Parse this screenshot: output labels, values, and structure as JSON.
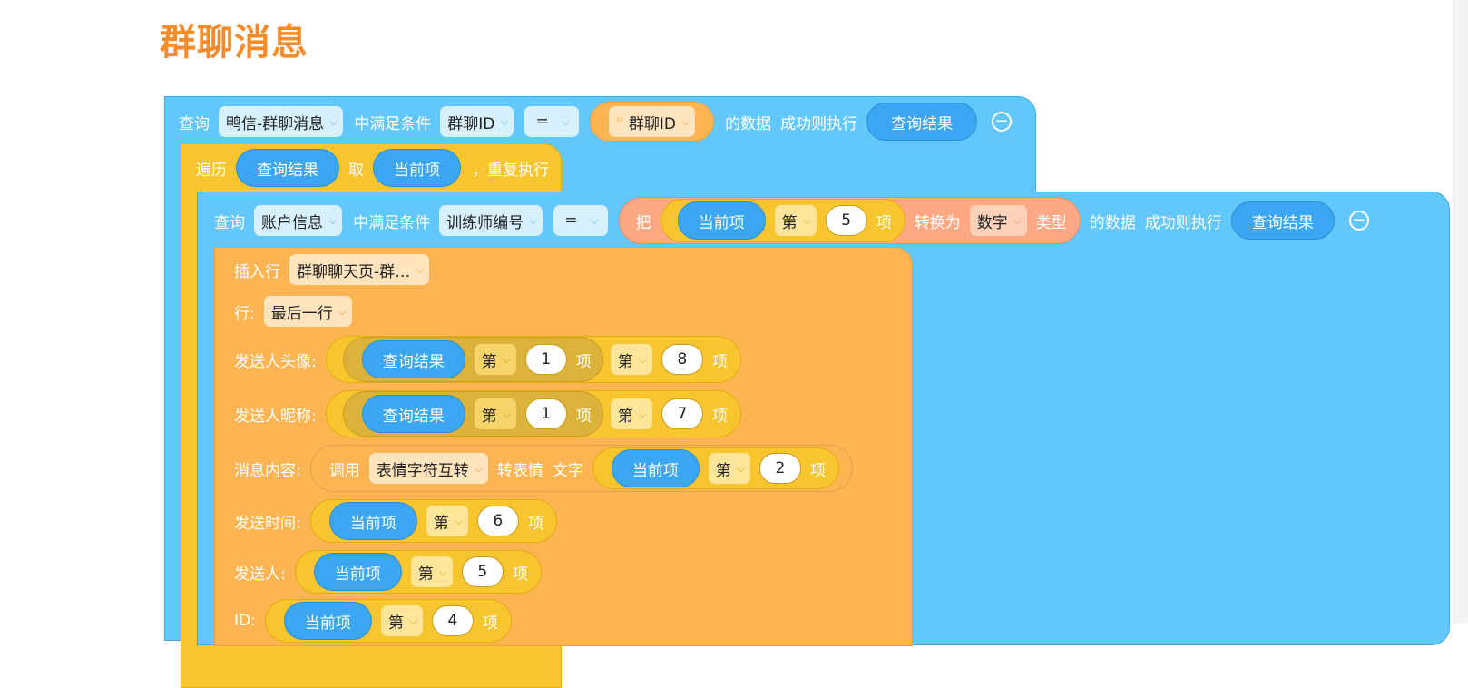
{
  "title": "群聊消息",
  "block1": {
    "kw_query": "查询",
    "table": "鸭信-群聊消息",
    "kw_where": "中满足条件",
    "field": "群聊ID",
    "op": "=",
    "value_field": "群聊ID",
    "value_type_icon": "¹²",
    "kw_data": "的数据",
    "kw_success": "成功则执行",
    "result": "查询结果"
  },
  "block2": {
    "kw_loop": "遍历",
    "list": "查询结果",
    "kw_take": "取",
    "item": "当前项",
    "kw_repeat": "，重复执行"
  },
  "block3": {
    "kw_query": "查询",
    "table": "账户信息",
    "kw_where": "中满足条件",
    "field": "训练师编号",
    "op": "=",
    "kw_convert": "把",
    "conv_item": "当前项",
    "conv_nth": "第",
    "conv_index": "5",
    "conv_xiang": "项",
    "kw_to": "转换为",
    "conv_type": "数字",
    "kw_type": "类型",
    "kw_data": "的数据",
    "kw_success": "成功则执行",
    "result": "查询结果"
  },
  "block4": {
    "kw_insert": "插入行",
    "insert_table": "群聊聊天页-群…",
    "row_label": "行:",
    "row_value": "最后一行",
    "fields": [
      {
        "label": "发送人头像:",
        "var": "查询结果",
        "nth": "第",
        "idx1": "1",
        "xiang": "项",
        "idx2": "8"
      },
      {
        "label": "发送人昵称:",
        "var": "查询结果",
        "nth": "第",
        "idx1": "1",
        "xiang": "项",
        "idx2": "7"
      }
    ],
    "msg": {
      "label": "消息内容:",
      "kw_call": "调用",
      "func": "表情字符互转",
      "kw_to_emoji": "转表情",
      "kw_text": "文字",
      "var": "当前项",
      "nth": "第",
      "idx": "2",
      "xiang": "项"
    },
    "simple": [
      {
        "label": "发送时间:",
        "var": "当前项",
        "nth": "第",
        "idx": "6",
        "xiang": "项"
      },
      {
        "label": "发送人:",
        "var": "当前项",
        "nth": "第",
        "idx": "5",
        "xiang": "项"
      },
      {
        "label": "ID:",
        "var": "当前项",
        "nth": "第",
        "idx": "4",
        "xiang": "项"
      }
    ]
  },
  "colors": {
    "title": "#f68b2c",
    "query_block": "#62c7fb",
    "loop_block": "#f7c52e",
    "insert_block": "#fdb554",
    "variable_pill": "#3ba7f3",
    "convert_block": "#fca885"
  }
}
